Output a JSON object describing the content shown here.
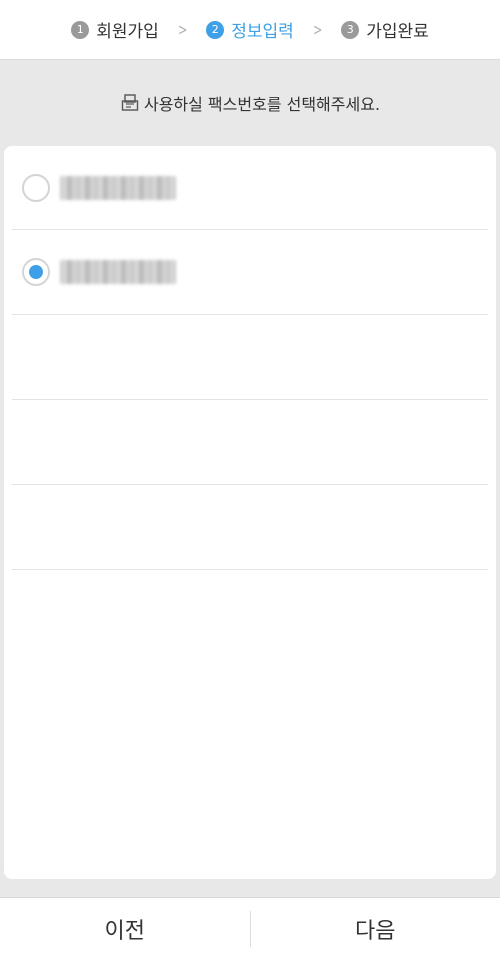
{
  "steps": [
    {
      "num": "1",
      "label": "회원가입"
    },
    {
      "num": "2",
      "label": "정보입력"
    },
    {
      "num": "3",
      "label": "가입완료"
    }
  ],
  "instruction": {
    "text": "사용하실 팩스번호를 선택해주세요.",
    "icon": "fax-document-icon"
  },
  "fax_list": {
    "items": [
      {
        "number": "0505-000-0000",
        "selected": false
      },
      {
        "number": "0505-000-0000",
        "selected": true
      }
    ]
  },
  "buttons": {
    "prev": "이전",
    "next": "다음"
  },
  "colors": {
    "accent": "#3ea0e6",
    "inactive_step": "#9a9a9a"
  }
}
